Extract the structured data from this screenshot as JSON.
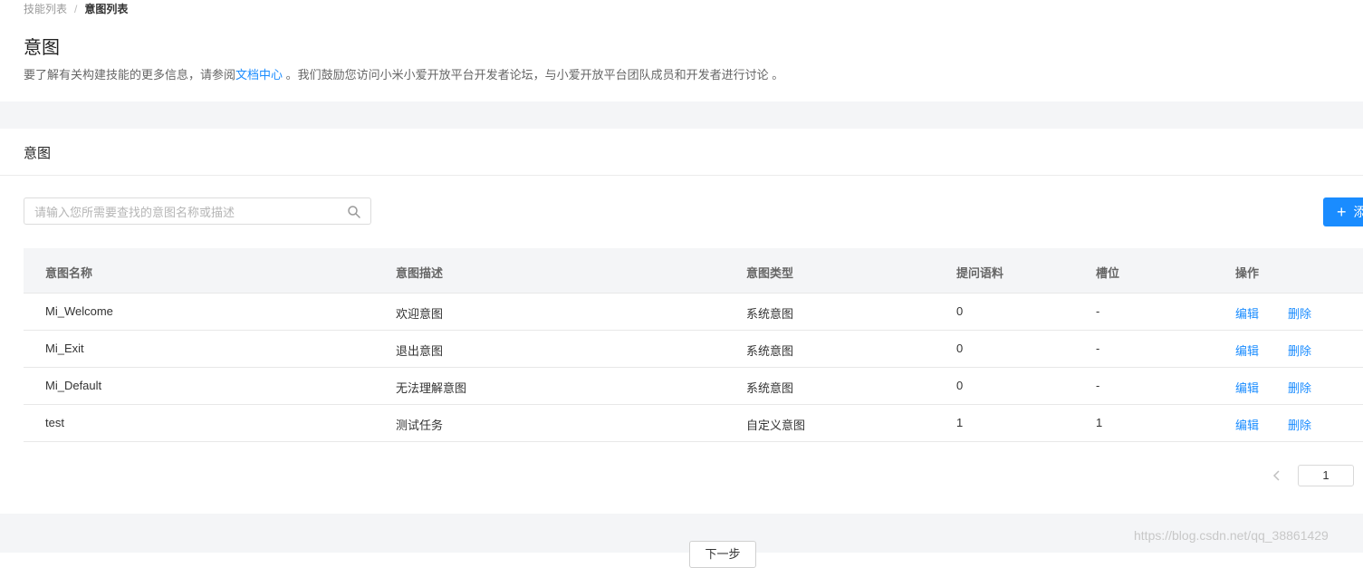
{
  "breadcrumb": {
    "parent": "技能列表",
    "separator": "/",
    "current": "意图列表"
  },
  "header": {
    "title": "意图",
    "desc_prefix": "要了解有关构建技能的更多信息，请参阅",
    "desc_link": "文档中心",
    "desc_suffix": " 。我们鼓励您访问小米小爱开放平台开发者论坛，与小爱开放平台团队成员和开发者进行讨论 。"
  },
  "card": {
    "title": "意图"
  },
  "search": {
    "placeholder": "请输入您所需要查找的意图名称或描述",
    "value": "",
    "icon": "search-icon"
  },
  "add_button": {
    "icon": "+",
    "label": "添"
  },
  "table": {
    "columns": [
      "意图名称",
      "意图描述",
      "意图类型",
      "提问语料",
      "槽位",
      "操作"
    ],
    "rows": [
      {
        "name": "Mi_Welcome",
        "desc": "欢迎意图",
        "type": "系统意图",
        "utterances": "0",
        "slots": "-",
        "edit": "编辑",
        "delete": "删除"
      },
      {
        "name": "Mi_Exit",
        "desc": "退出意图",
        "type": "系统意图",
        "utterances": "0",
        "slots": "-",
        "edit": "编辑",
        "delete": "删除"
      },
      {
        "name": "Mi_Default",
        "desc": "无法理解意图",
        "type": "系统意图",
        "utterances": "0",
        "slots": "-",
        "edit": "编辑",
        "delete": "删除"
      },
      {
        "name": "test",
        "desc": "测试任务",
        "type": "自定义意图",
        "utterances": "1",
        "slots": "1",
        "edit": "编辑",
        "delete": "删除"
      }
    ]
  },
  "pagination": {
    "current_page": "1",
    "prev_icon": "chevron-left-icon"
  },
  "footer": {
    "next_button": "下一步"
  },
  "watermark": "https://blog.csdn.net/qq_38861429",
  "colors": {
    "accent": "#1a8cff",
    "band": "#f4f5f7",
    "border": "#e8e8e8"
  }
}
